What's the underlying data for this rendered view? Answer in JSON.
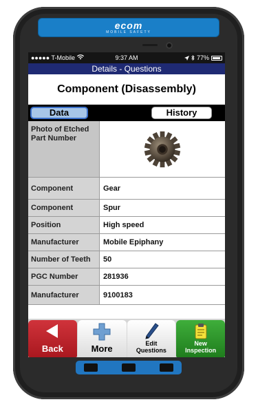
{
  "device": {
    "brand": "ecom",
    "brand_sub": "MOBILE SAFETY",
    "brand_color": "#1a7fc8"
  },
  "status": {
    "carrier": "●●●●● T-Mobile",
    "wifi_icon": "wifi-icon",
    "time": "9:37 AM",
    "location_icon": "location-arrow-icon",
    "bluetooth_icon": "bluetooth-icon",
    "battery": "77%",
    "battery_level": 0.77
  },
  "screen": {
    "title": "Details - Questions",
    "heading": "Component (Disassembly)"
  },
  "tabs": {
    "data_label": "Data",
    "history_label": "History",
    "active": "Data"
  },
  "fields": {
    "photo_label": "Photo of Etched Part Number",
    "rows": [
      {
        "label": "Component",
        "value": "Gear"
      },
      {
        "label": "Component",
        "value": "Spur"
      },
      {
        "label": "Position",
        "value": "High speed"
      },
      {
        "label": "Manufacturer",
        "value": "Mobile Epiphany"
      },
      {
        "label": "Number of Teeth",
        "value": "50"
      },
      {
        "label": "PGC Number",
        "value": "281936"
      },
      {
        "label": "Manufacturer",
        "value": "9100183"
      }
    ]
  },
  "toolbar": {
    "back_label": "Back",
    "more_label": "More",
    "edit_label_1": "Edit",
    "edit_label_2": "Questions",
    "new_label_1": "New",
    "new_label_2": "Inspection",
    "colors": {
      "back": "#c0262d",
      "new": "#2e9a2b",
      "title": "#1f2a73"
    }
  }
}
